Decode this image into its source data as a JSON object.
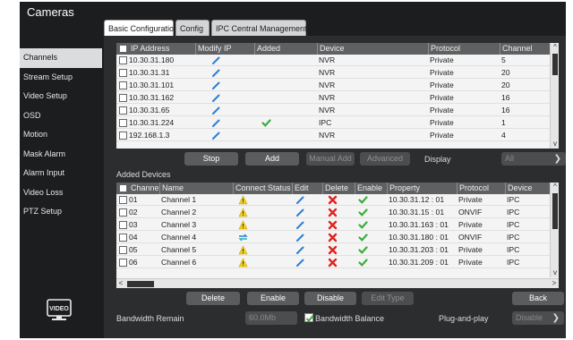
{
  "window": {
    "title": "Cameras"
  },
  "tabs": [
    {
      "label": "Basic Configuration",
      "active": true
    },
    {
      "label": "Config",
      "active": false
    },
    {
      "label": "IPC Central Management",
      "active": false
    }
  ],
  "sidebar": {
    "items": [
      {
        "label": "Channels",
        "active": true
      },
      {
        "label": "Stream Setup"
      },
      {
        "label": "Video Setup"
      },
      {
        "label": "OSD"
      },
      {
        "label": "Motion"
      },
      {
        "label": "Mask Alarm"
      },
      {
        "label": "Alarm Input"
      },
      {
        "label": "Video Loss"
      },
      {
        "label": "PTZ Setup"
      }
    ],
    "logo_text": "VIDEO"
  },
  "discovered": {
    "columns": [
      "IP Address",
      "Modify IP",
      "Added",
      "Device",
      "Protocol",
      "Channel"
    ],
    "rows": [
      {
        "ip": "10.30.31.180",
        "added": false,
        "device": "NVR",
        "protocol": "Private",
        "channel": "5"
      },
      {
        "ip": "10.30.31.31",
        "added": false,
        "device": "NVR",
        "protocol": "Private",
        "channel": "20"
      },
      {
        "ip": "10.30.31.101",
        "added": false,
        "device": "NVR",
        "protocol": "Private",
        "channel": "20"
      },
      {
        "ip": "10.30.31.162",
        "added": false,
        "device": "NVR",
        "protocol": "Private",
        "channel": "16"
      },
      {
        "ip": "10.30.31.65",
        "added": false,
        "device": "NVR",
        "protocol": "Private",
        "channel": "16"
      },
      {
        "ip": "10.30.31.224",
        "added": true,
        "device": "IPC",
        "protocol": "Private",
        "channel": "1"
      },
      {
        "ip": "192.168.1.3",
        "added": false,
        "device": "NVR",
        "protocol": "Private",
        "channel": "4"
      }
    ]
  },
  "search_buttons": {
    "stop": "Stop",
    "add": "Add",
    "manual_add": "Manual Add",
    "advanced": "Advanced",
    "display_label": "Display",
    "display_value": "All"
  },
  "added_devices": {
    "title": "Added Devices",
    "columns": [
      "Channel",
      "Name",
      "Connect Status",
      "Edit",
      "Delete",
      "Enable",
      "Property",
      "Protocol",
      "Device"
    ],
    "rows": [
      {
        "channel": "01",
        "name": "Channel 1",
        "status": "warning",
        "property": "10.30.31.12 : 01",
        "protocol": "Private",
        "device": "IPC"
      },
      {
        "channel": "02",
        "name": "Channel 2",
        "status": "warning",
        "property": "10.30.31.15 : 01",
        "protocol": "ONVIF",
        "device": "IPC"
      },
      {
        "channel": "03",
        "name": "Channel 3",
        "status": "warning",
        "property": "10.30.31.163 : 01",
        "protocol": "Private",
        "device": "IPC"
      },
      {
        "channel": "04",
        "name": "Channel 4",
        "status": "connected",
        "property": "10.30.31.180 : 01",
        "protocol": "ONVIF",
        "device": "IPC"
      },
      {
        "channel": "05",
        "name": "Channel 5",
        "status": "warning",
        "property": "10.30.31.203 : 01",
        "protocol": "Private",
        "device": "IPC"
      },
      {
        "channel": "06",
        "name": "Channel 6",
        "status": "warning",
        "property": "10.30.31.209 : 01",
        "protocol": "Private",
        "device": "IPC"
      }
    ]
  },
  "bottom_buttons": {
    "delete": "Delete",
    "enable": "Enable",
    "disable": "Disable",
    "edit_type": "Edit Type",
    "back": "Back"
  },
  "footer": {
    "bandwidth_remain_label": "Bandwidth Remain",
    "bandwidth_remain_value": "60.0Mb",
    "bandwidth_balance_label": "Bandwidth Balance",
    "bandwidth_balance_checked": true,
    "plug_and_play_label": "Plug-and-play",
    "plug_and_play_value": "Disable"
  },
  "colors": {
    "edit_icon": "#2b7fd6",
    "check_icon": "#3cab3c",
    "delete_icon": "#e0231f",
    "warning_icon": "#f2d21c"
  }
}
